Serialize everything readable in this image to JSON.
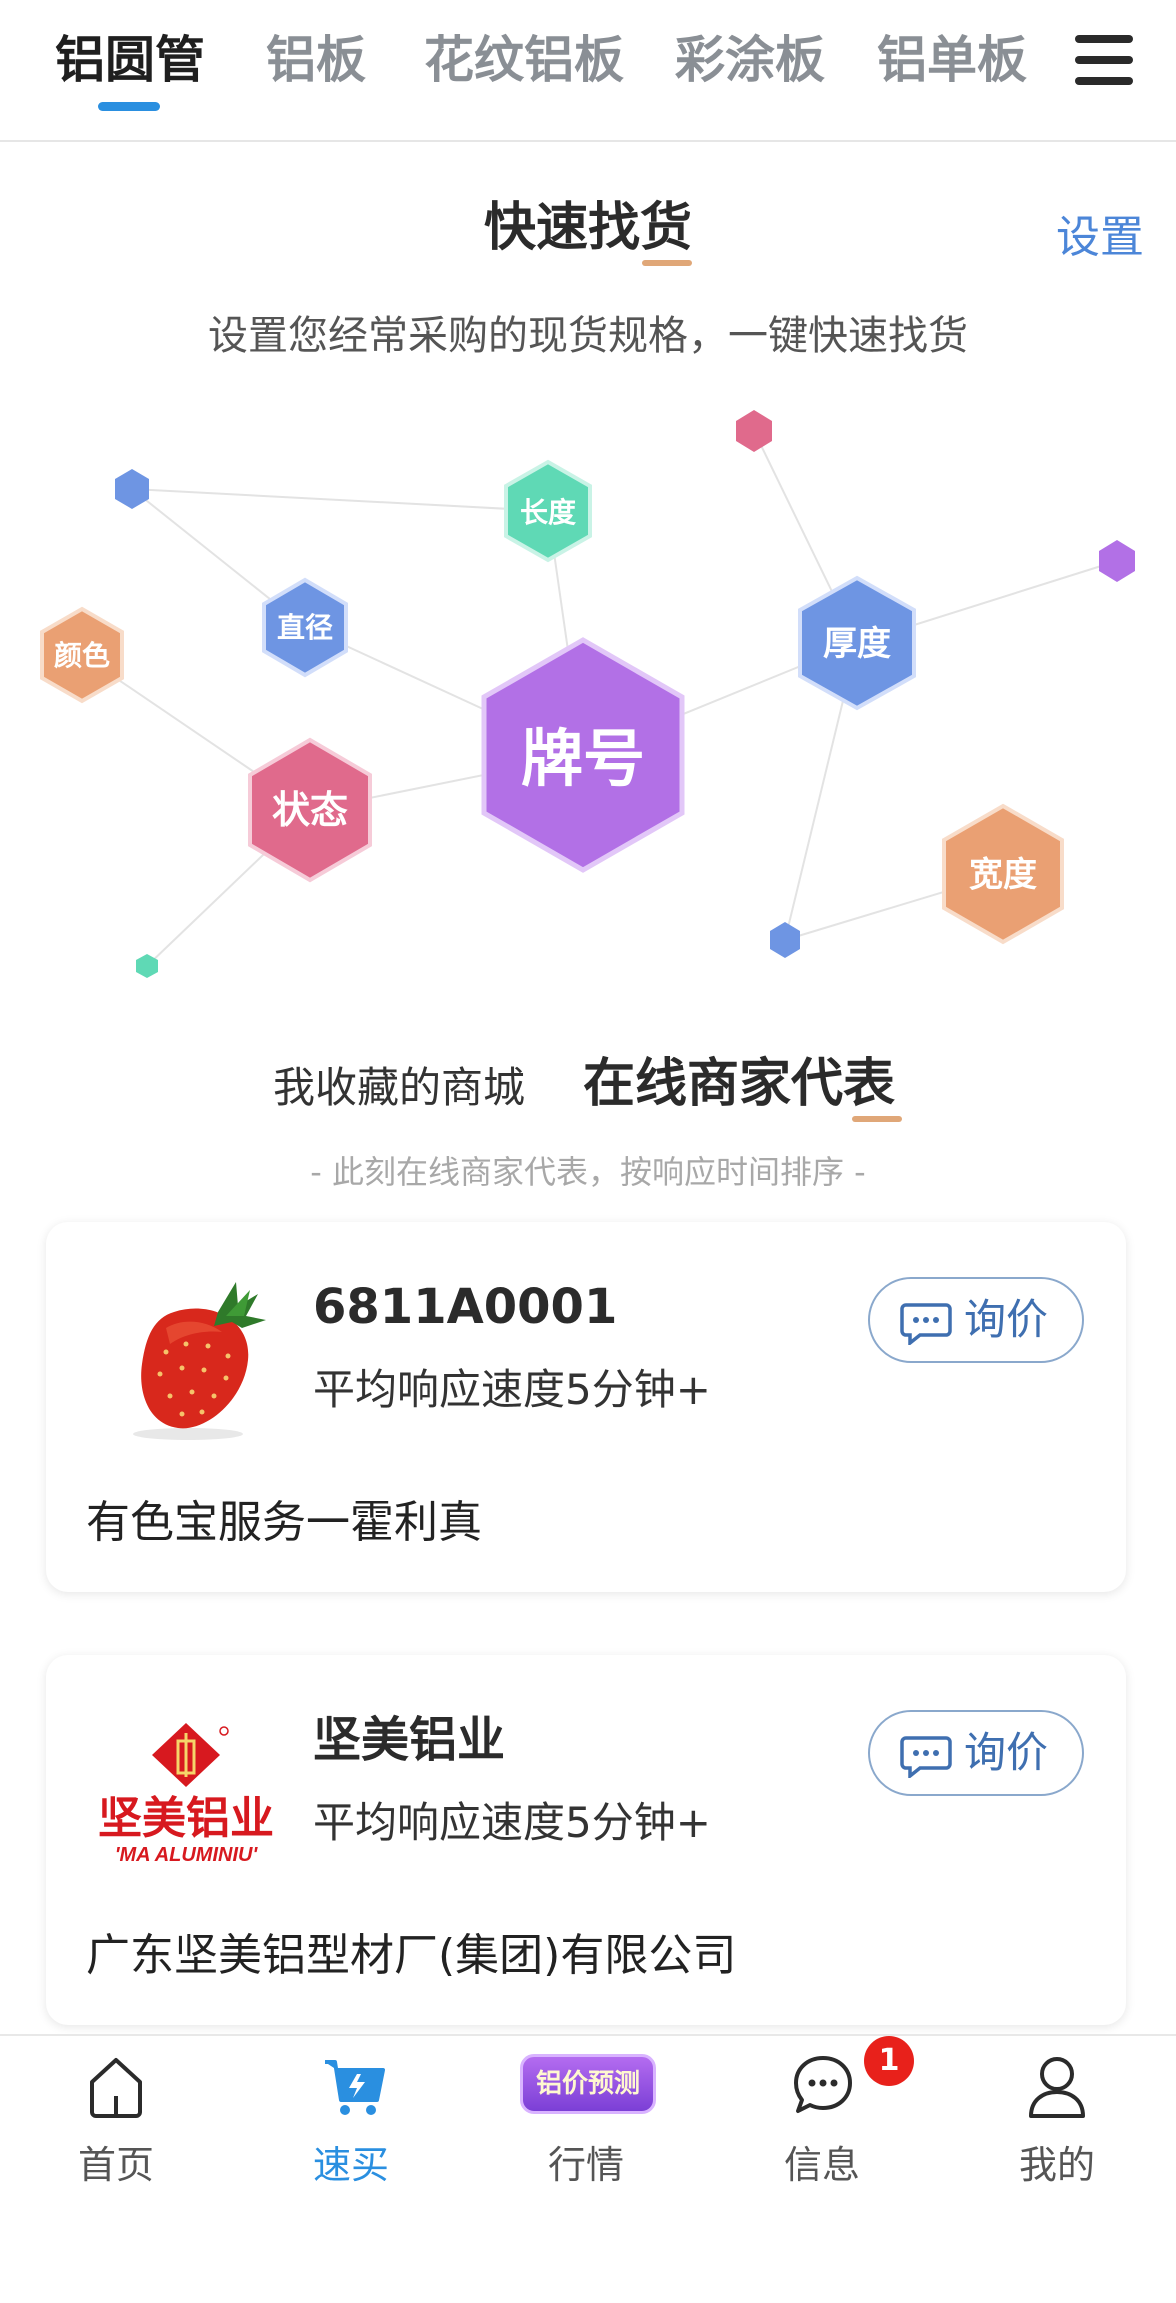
{
  "top_tabs": [
    {
      "label": "铝圆管",
      "active": true
    },
    {
      "label": "铝板",
      "active": false
    },
    {
      "label": "花纹铝板",
      "active": false
    },
    {
      "label": "彩涂板",
      "active": false
    },
    {
      "label": "铝单板",
      "active": false
    }
  ],
  "menu_icon": "hamburger-menu-icon",
  "quick_find": {
    "title": "快速找货",
    "settings_label": "设置",
    "description": "设置您经常采购的现货规格，一键快速找货",
    "nodes": [
      {
        "label": "牌号",
        "color": "#b270e6"
      },
      {
        "label": "长度",
        "color": "#5fd9b5"
      },
      {
        "label": "直径",
        "color": "#6e95e3"
      },
      {
        "label": "颜色",
        "color": "#eaa073"
      },
      {
        "label": "状态",
        "color": "#e06a8c"
      },
      {
        "label": "厚度",
        "color": "#6e95e3"
      },
      {
        "label": "宽度",
        "color": "#eaa073"
      }
    ]
  },
  "merchants": {
    "tab_favorites": "我收藏的商城",
    "tab_online": "在线商家代表",
    "subtitle": "- 此刻在线商家代表，按响应时间排序 -",
    "inquiry_label": "询价",
    "items": [
      {
        "name": "6811A0001",
        "speed": "平均响应速度5分钟+",
        "company": "有色宝服务一霍利真",
        "logo": "strawberry-avatar"
      },
      {
        "name": "坚美铝业",
        "speed": "平均响应速度5分钟+",
        "company": "广东坚美铝型材厂(集团)有限公司",
        "logo": "jianmei-logo",
        "logo_text_cn": "坚美铝业",
        "logo_text_en": "'MA  ALUMINIU'"
      }
    ]
  },
  "bottom_nav": {
    "items": [
      {
        "label": "首页",
        "icon": "home-icon",
        "active": false
      },
      {
        "label": "速买",
        "icon": "cart-icon",
        "active": true
      },
      {
        "label": "行情",
        "icon": "forecast-badge",
        "badge_text": "铝价预测",
        "active": false
      },
      {
        "label": "信息",
        "icon": "chat-icon",
        "active": false,
        "unread": "1"
      },
      {
        "label": "我的",
        "icon": "user-icon",
        "active": false
      }
    ]
  },
  "colors": {
    "accent_blue": "#2a8fe0",
    "link_blue": "#4c86d8",
    "underline_orange": "#e0a778",
    "badge_red": "#e8211b"
  }
}
